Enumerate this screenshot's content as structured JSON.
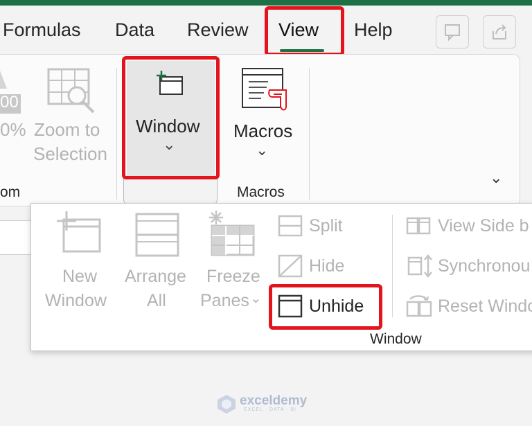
{
  "tabs": [
    {
      "label": "Formulas"
    },
    {
      "label": "Data"
    },
    {
      "label": "Review"
    },
    {
      "label": "View"
    },
    {
      "label": "Help"
    }
  ],
  "ribbon": {
    "zoom_partial_value": "00",
    "zoom_partial_percent": "0%",
    "zoom_to_selection": {
      "line1": "Zoom to",
      "line2": "Selection"
    },
    "zoom_group_label_partial": "om",
    "window_button": {
      "label": "Window",
      "chevron": "⌄"
    },
    "macros_button": {
      "label": "Macros",
      "chevron": "⌄"
    },
    "macros_group_label": "Macros",
    "expand_chevron": "⌄"
  },
  "window_dropdown": {
    "new_window": {
      "line1": "New",
      "line2": "Window"
    },
    "arrange_all": {
      "line1": "Arrange",
      "line2": "All"
    },
    "freeze_panes": {
      "line1": "Freeze",
      "line2": "Panes",
      "chevron": "⌄"
    },
    "split": "Split",
    "hide": "Hide",
    "unhide": "Unhide",
    "view_side_by_side": "View Side b",
    "synchronous_scrolling": "Synchronou",
    "reset_window_position": "Reset Windo",
    "group_label": "Window"
  },
  "watermark": {
    "name": "exceldemy",
    "tagline": "EXCEL · DATA · BI"
  },
  "colors": {
    "accent": "#1e7145",
    "highlight": "#e3141b",
    "disabled": "#b3b3b3"
  }
}
